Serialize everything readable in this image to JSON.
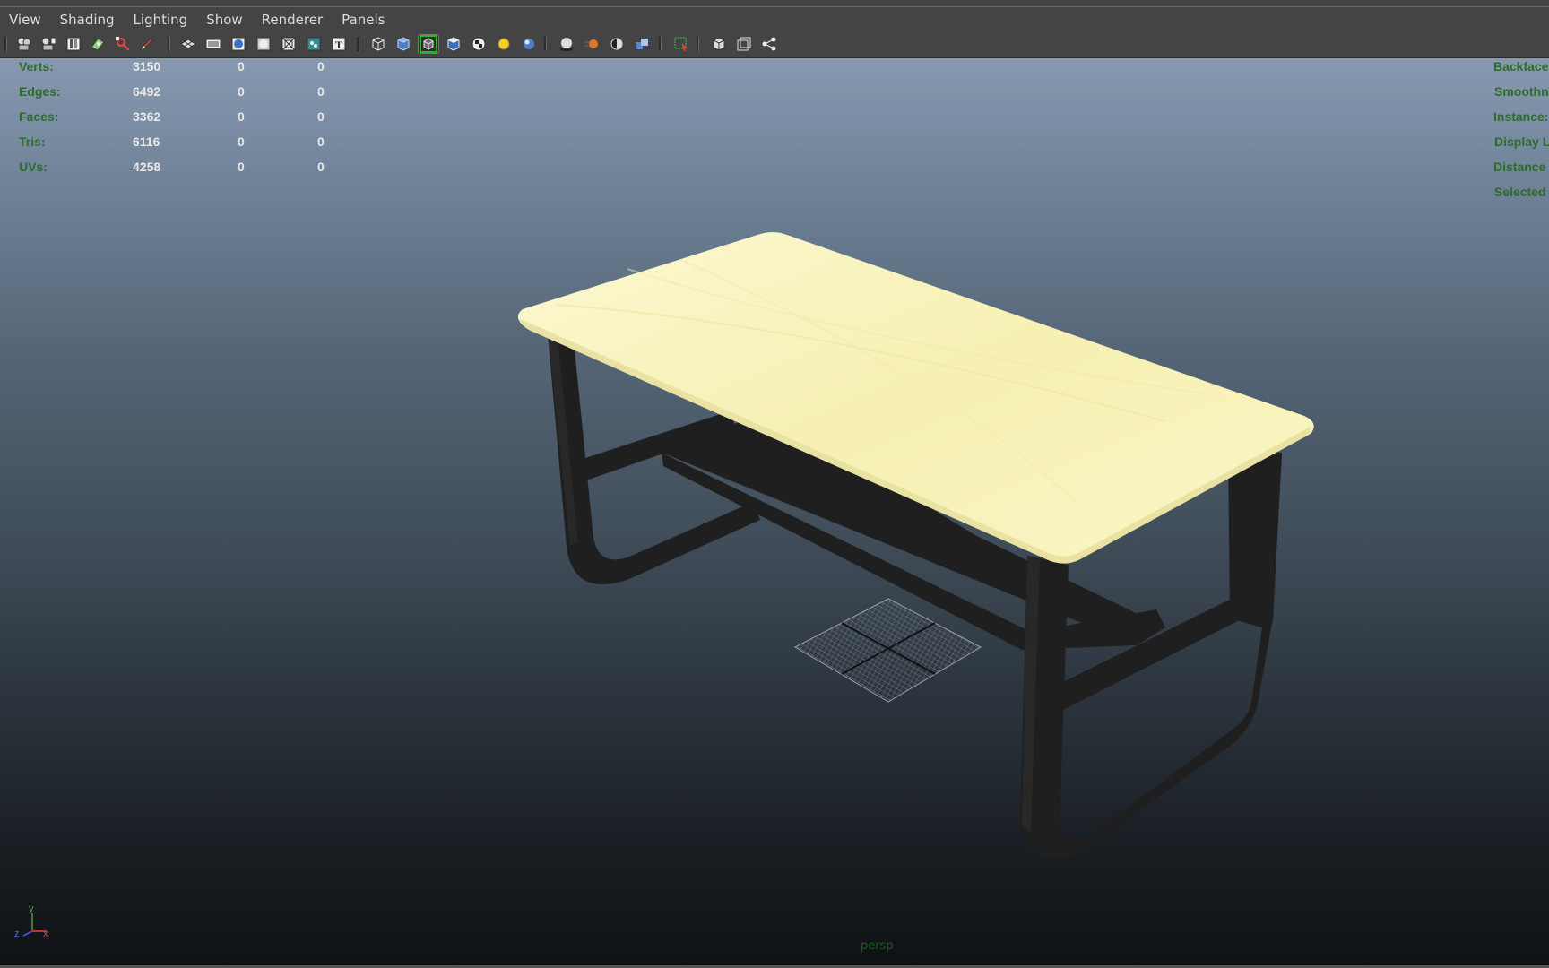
{
  "menubar": {
    "items": [
      "View",
      "Shading",
      "Lighting",
      "Show",
      "Renderer",
      "Panels"
    ]
  },
  "toolbar": {
    "icons": [
      "select-camera-icon",
      "camera-attributes-icon",
      "bookmark-icon",
      "image-plane-icon",
      "two-d-pan-zoom-icon",
      "grease-pencil-icon",
      "grid-icon",
      "film-gate-icon",
      "resolution-gate-icon",
      "gate-mask-icon",
      "field-chart-icon",
      "safe-action-icon",
      "safe-title-icon",
      "wireframe-icon",
      "smooth-shade-icon",
      "wireframe-on-shaded-icon",
      "flat-shade-icon",
      "textured-icon",
      "use-all-lights-icon",
      "shadows-icon",
      "screen-space-ambient-occlusion-icon",
      "motion-blur-icon",
      "multisample-aa-icon",
      "depth-of-field-icon",
      "isolate-select-icon",
      "xray-icon",
      "xray-joints-icon",
      "node-editor-icon"
    ],
    "active_icon": "wireframe-on-shaded-icon"
  },
  "hud": {
    "stats": [
      {
        "label": "Verts:",
        "total": "3150",
        "selected": "0",
        "tweak": "0"
      },
      {
        "label": "Edges:",
        "total": "6492",
        "selected": "0",
        "tweak": "0"
      },
      {
        "label": "Faces:",
        "total": "3362",
        "selected": "0",
        "tweak": "0"
      },
      {
        "label": "Tris:",
        "total": "6116",
        "selected": "0",
        "tweak": "0"
      },
      {
        "label": "UVs:",
        "total": "4258",
        "selected": "0",
        "tweak": "0"
      }
    ],
    "right": [
      "Backface",
      "Smoothne",
      "Instance:",
      "Display L",
      "Distance",
      "Selected"
    ]
  },
  "viewport": {
    "camera": "persp",
    "axis": {
      "y": "y",
      "x": "x",
      "z": "z"
    }
  },
  "colors": {
    "hud_label": "#2e6b2e",
    "tabletop": "#f7f2b8",
    "table_frame": "#1f1f1f",
    "active_highlight": "#1fbf1f"
  }
}
